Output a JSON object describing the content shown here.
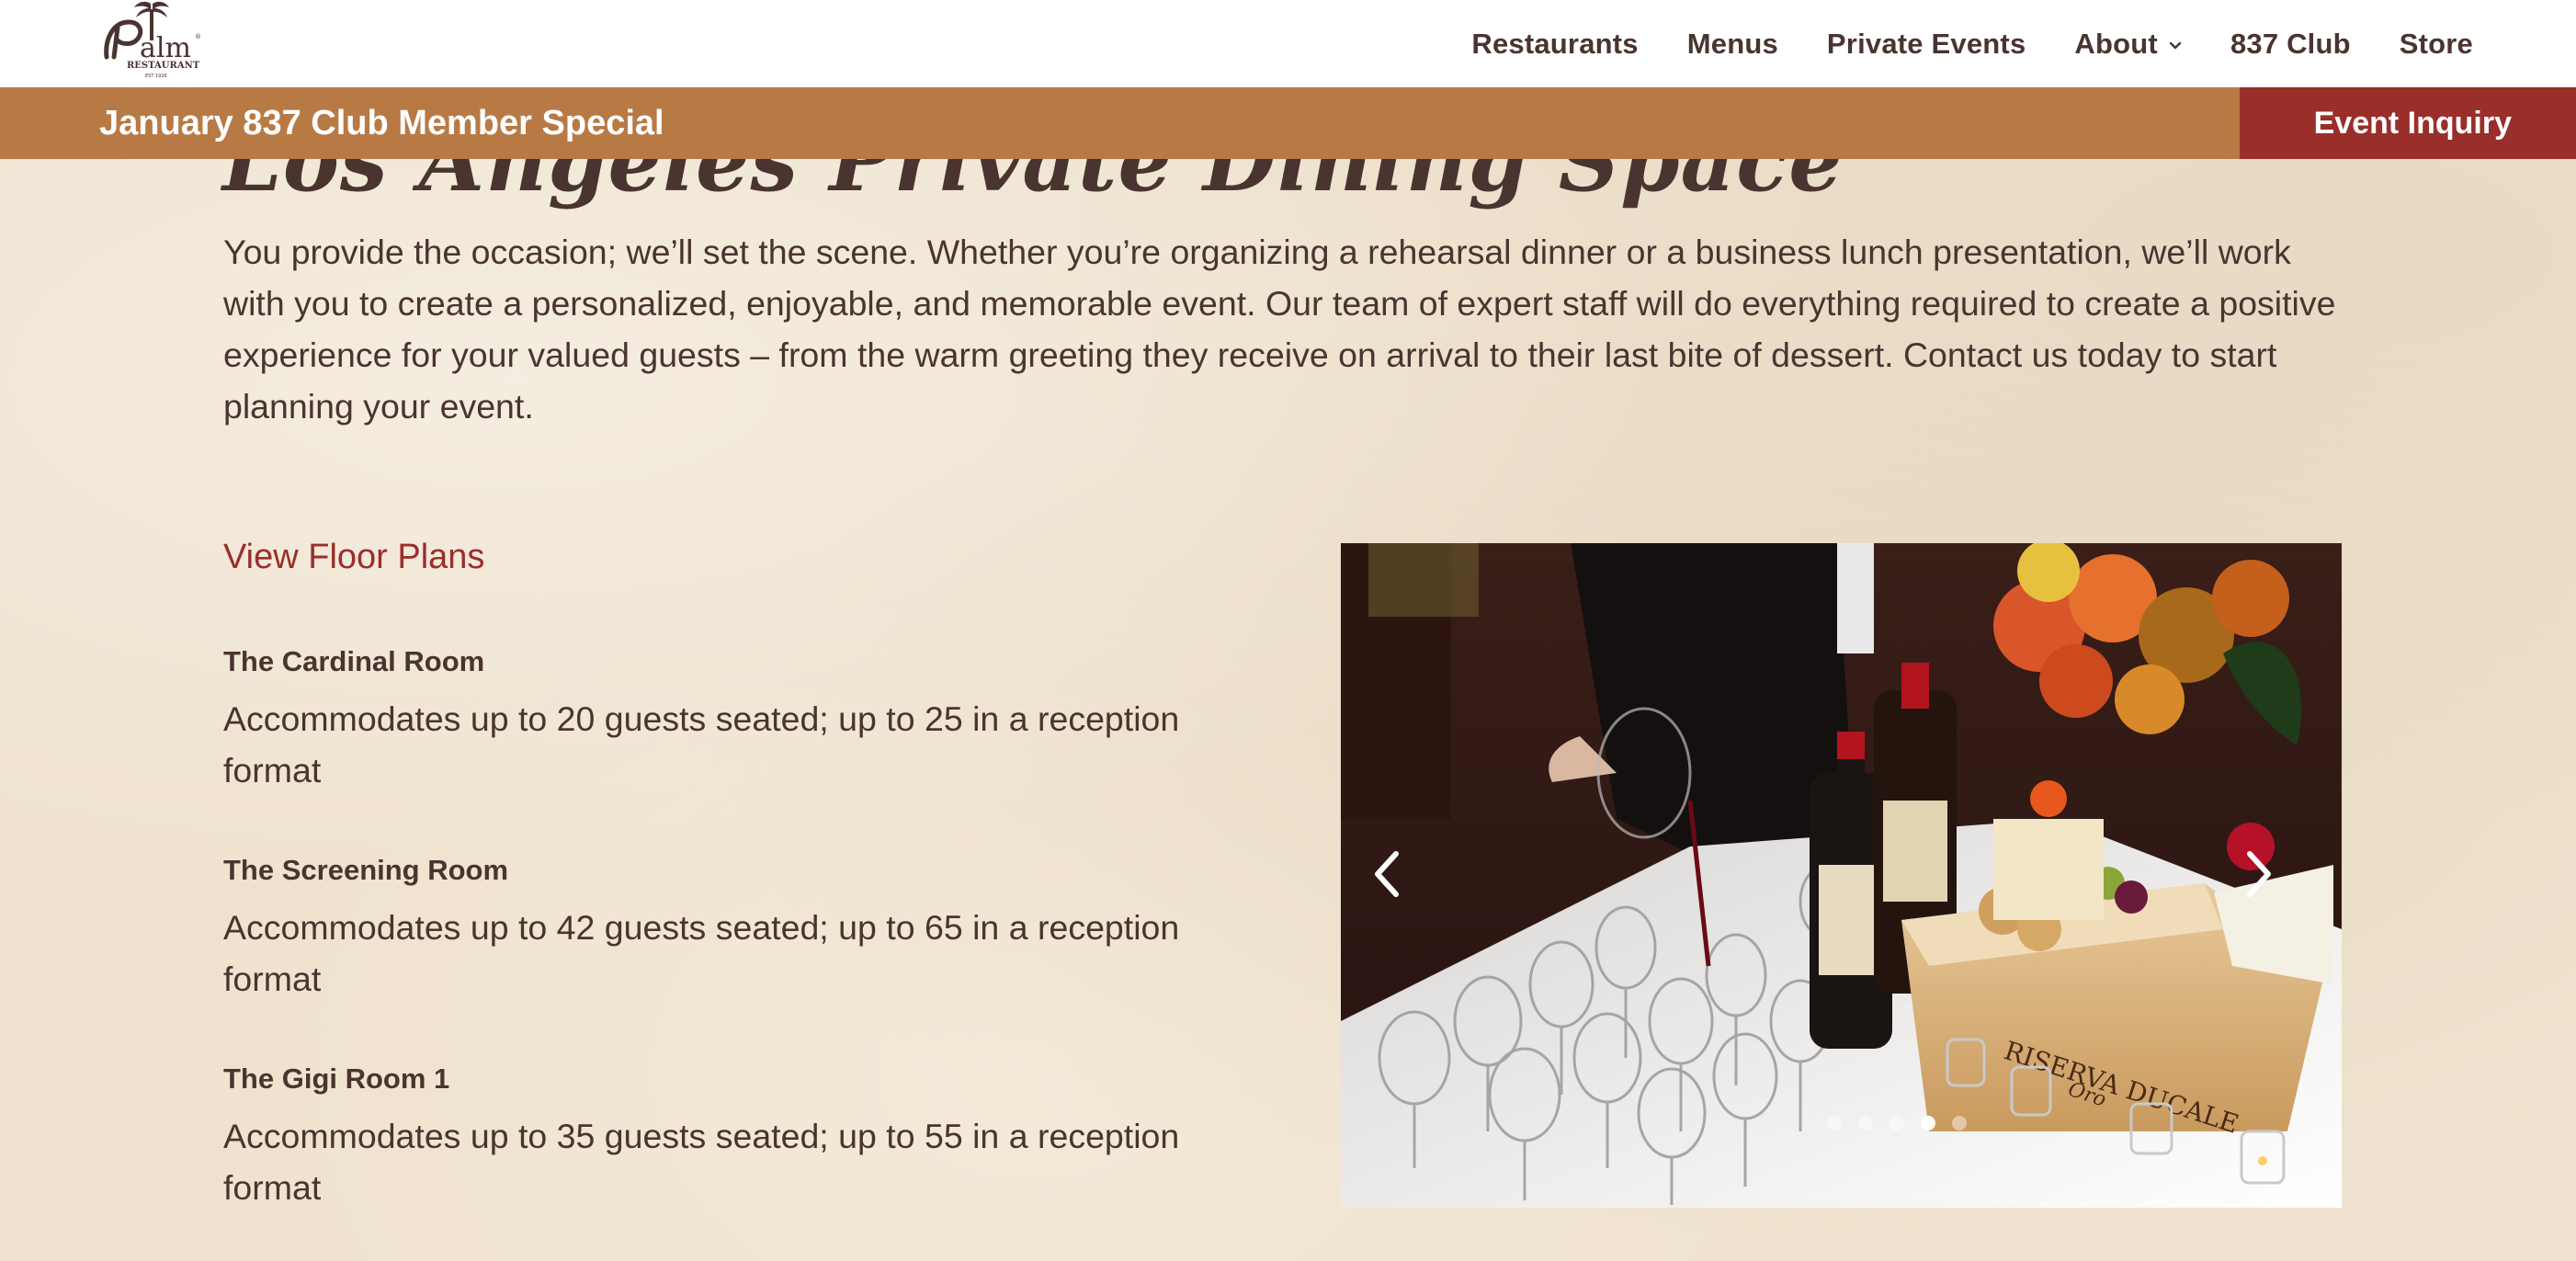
{
  "header": {
    "logo_alt": "Palm Restaurant",
    "nav": [
      {
        "label": "Restaurants"
      },
      {
        "label": "Menus"
      },
      {
        "label": "Private Events"
      },
      {
        "label": "About"
      },
      {
        "label": "837 Club"
      },
      {
        "label": "Store"
      }
    ]
  },
  "promo": {
    "text": "January 837 Club Member Special",
    "inquiry_label": "Event Inquiry"
  },
  "main": {
    "title": "Los Angeles Private Dining Space",
    "intro": "You provide the occasion; we’ll set the scene. Whether you’re organizing a rehearsal dinner or a business lunch presentation, we’ll work with you to create a personalized, enjoyable, and memorable event. Our team of expert staff will do everything required to create a positive experience for your valued guests – from the warm greeting they receive on arrival to their last bite of dessert. Contact us today to start planning your event.",
    "floor_plans_link": "View Floor Plans",
    "rooms": [
      {
        "name": "The Cardinal Room",
        "description": "Accommodates up to 20 guests seated; up to 25 in a reception format"
      },
      {
        "name": "The Screening Room",
        "description": "Accommodates up to 42 guests seated; up to 65 in a reception format"
      },
      {
        "name": "The Gigi Room 1",
        "description": "Accommodates up to 35 guests seated; up to 55 in a reception format"
      }
    ]
  },
  "carousel": {
    "slide_count": 5,
    "active_slide": 4
  },
  "colors": {
    "brand_brown": "#4a3430",
    "banner": "#b87a45",
    "inquiry": "#9a2e2a",
    "link": "#9a2e2a",
    "background": "#efe3cf"
  },
  "icons": {
    "dropdown": "chevron-down-icon",
    "prev": "chevron-left-icon",
    "next": "chevron-right-icon"
  }
}
